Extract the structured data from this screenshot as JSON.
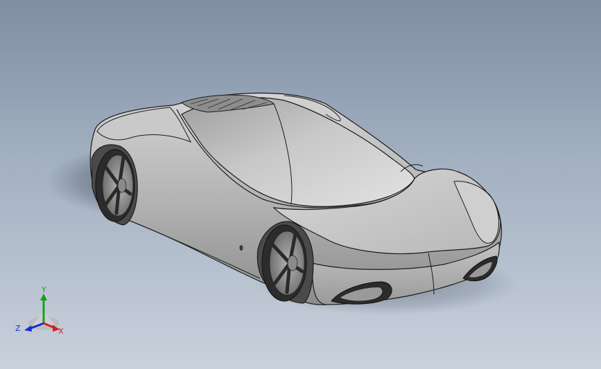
{
  "viewport": {
    "background_top": "#7f8ea3",
    "background_bottom": "#c9d1dc"
  },
  "model": {
    "body_color": "#b9b9b9",
    "edge_color": "#1a1a1a"
  },
  "triad": {
    "x_label": "X",
    "y_label": "Y",
    "z_label": "Z",
    "x_color": "#d42020",
    "y_color": "#1aa01a",
    "z_color": "#1a2ad4"
  }
}
